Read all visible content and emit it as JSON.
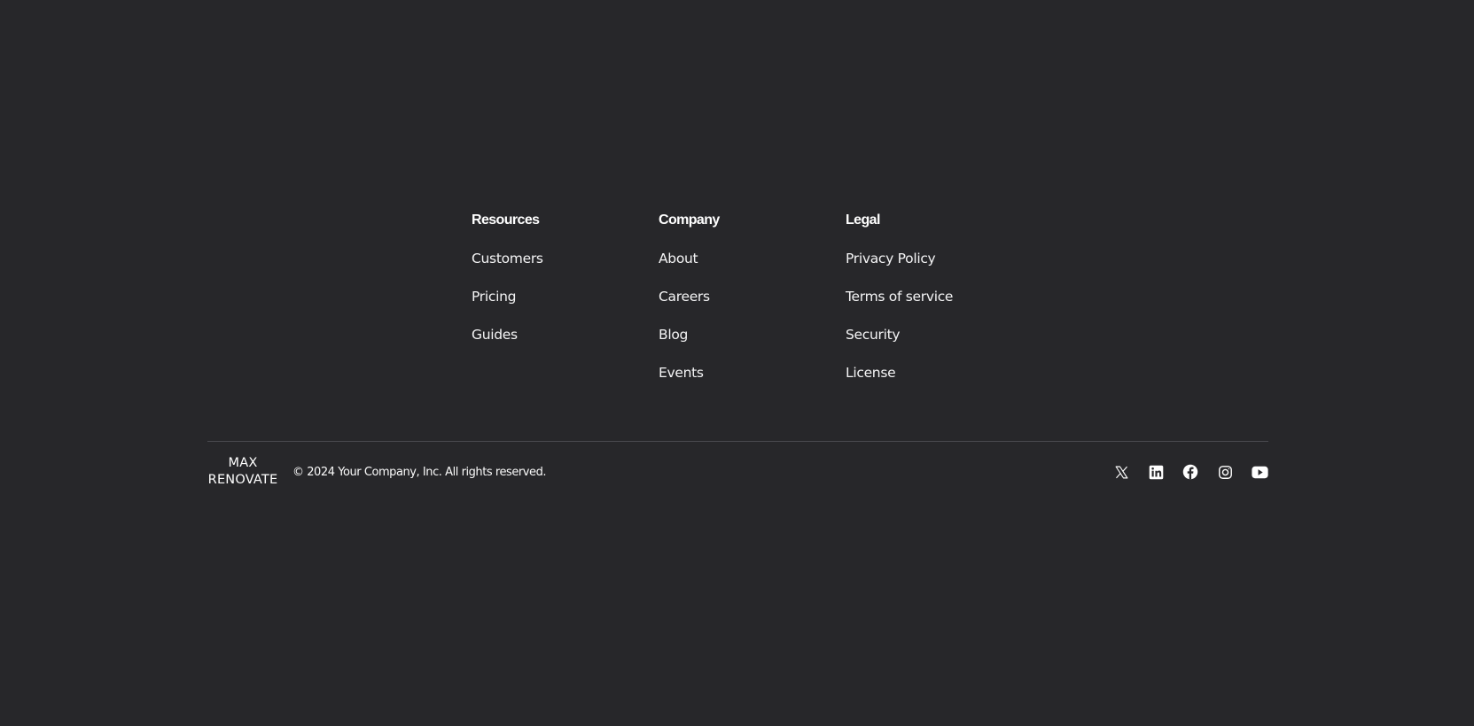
{
  "footer": {
    "columns": [
      {
        "heading": "Resources",
        "links": [
          "Customers",
          "Pricing",
          "Guides"
        ]
      },
      {
        "heading": "Company",
        "links": [
          "About",
          "Careers",
          "Blog",
          "Events"
        ]
      },
      {
        "heading": "Legal",
        "links": [
          "Privacy Policy",
          "Terms of service",
          "Security",
          "License"
        ]
      }
    ],
    "logo": {
      "line1": "MAX",
      "line2": "RENOVATE"
    },
    "copyright": "© 2024 Your Company, Inc. All rights reserved.",
    "socials": [
      "x-icon",
      "linkedin-icon",
      "facebook-icon",
      "instagram-icon",
      "youtube-icon"
    ],
    "colors": {
      "background": "#27272a",
      "text": "#ffffff",
      "divider": "#4a4a4f"
    }
  }
}
